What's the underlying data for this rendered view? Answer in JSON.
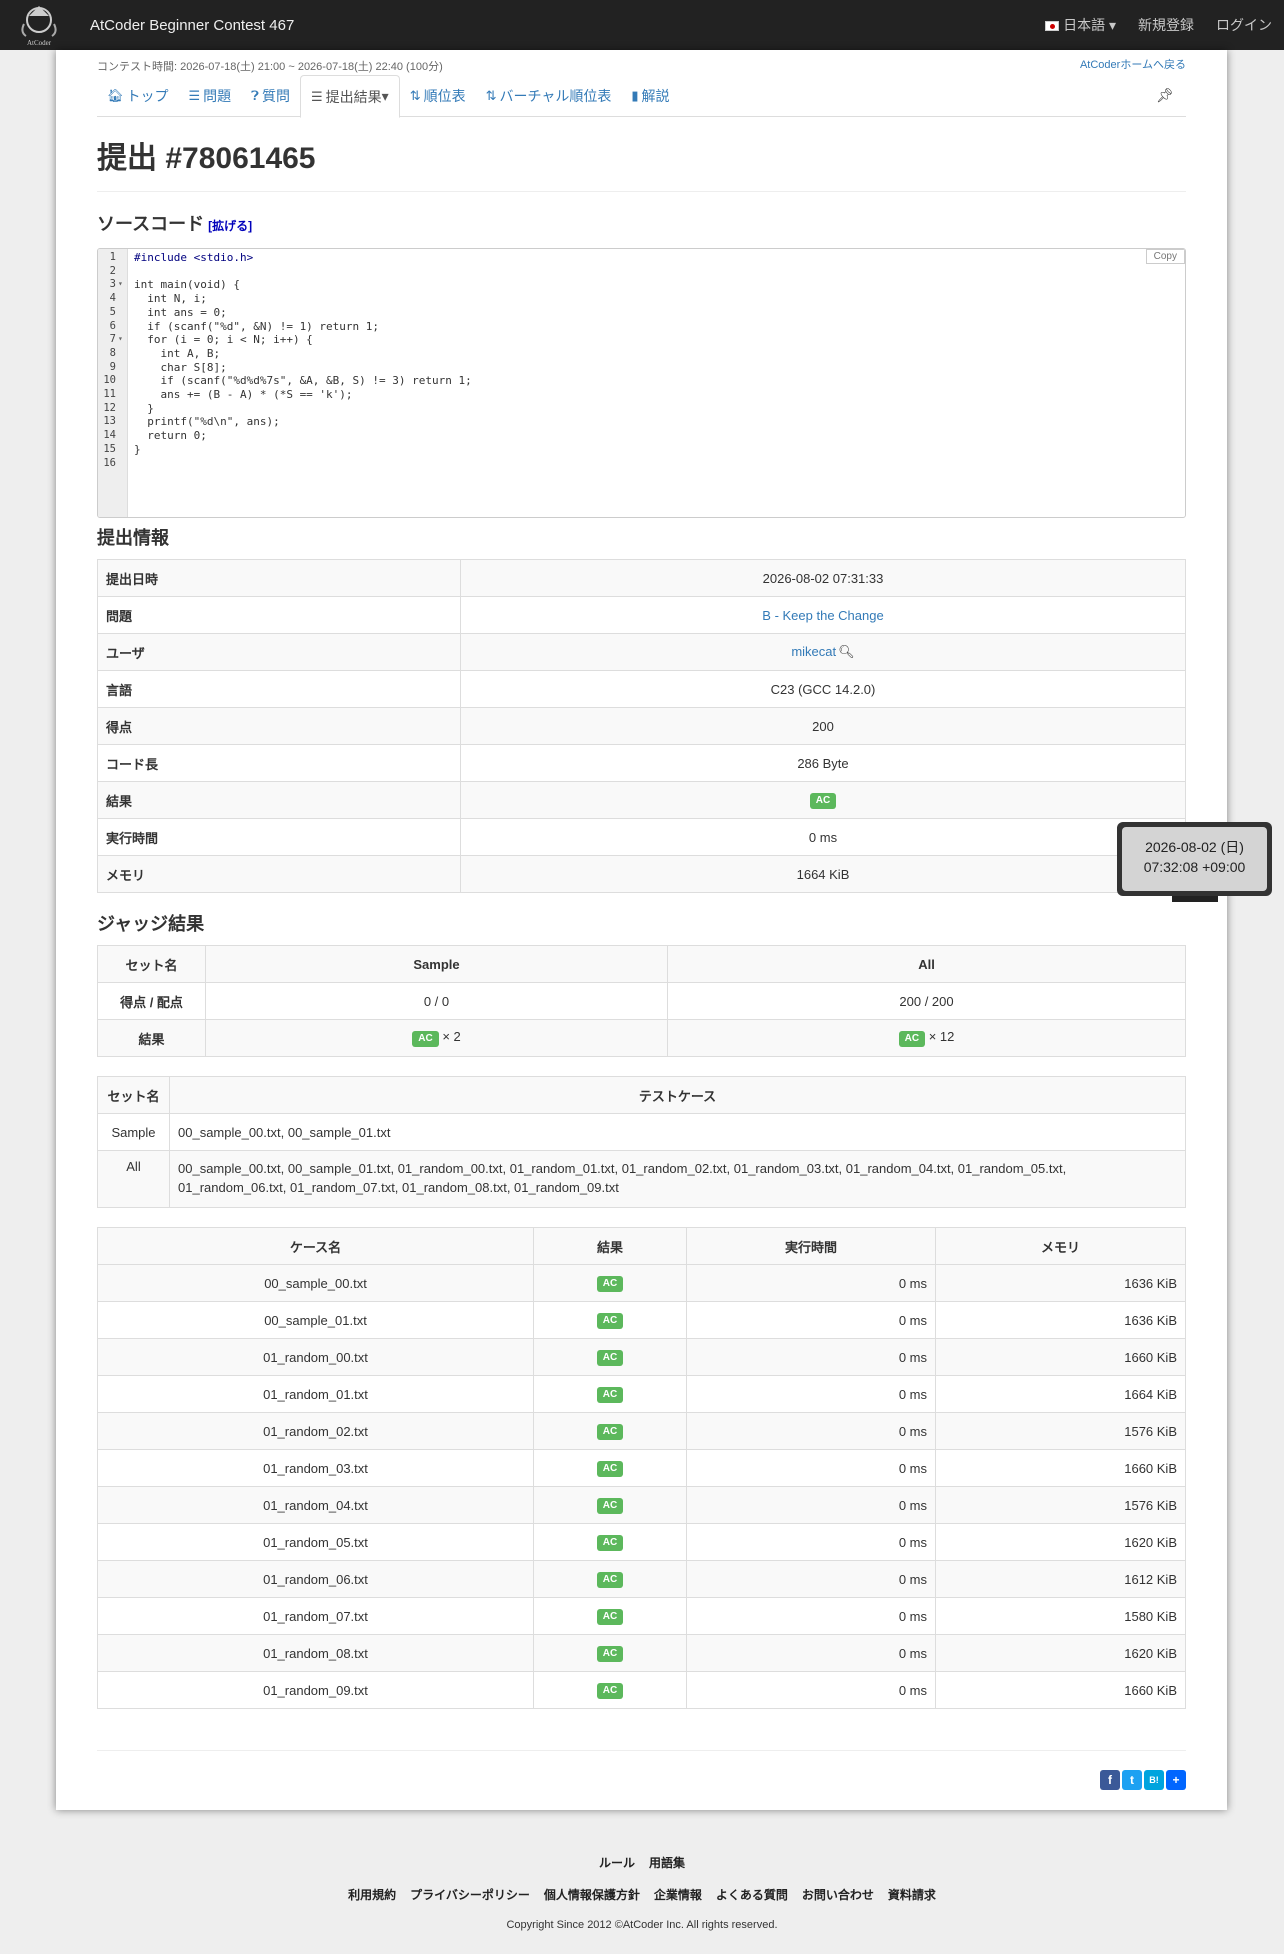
{
  "navbar": {
    "logo_text": "AtCoder",
    "contest_title": "AtCoder Beginner Contest 467",
    "language": "日本語",
    "signup": "新規登録",
    "login": "ログイン"
  },
  "contest_time": "コンテスト時間: 2026-07-18(土) 21:00 ~ 2026-07-18(土) 22:40 (100分)",
  "home_link": "AtCoderホームへ戻る",
  "tabs": [
    {
      "icon": "home-icon",
      "label": "トップ"
    },
    {
      "icon": "list-icon",
      "label": "問題"
    },
    {
      "icon": "question-icon",
      "label": "質問"
    },
    {
      "icon": "list-icon",
      "label": "提出結果"
    },
    {
      "icon": "sort-icon",
      "label": "順位表"
    },
    {
      "icon": "sort-icon",
      "label": "バーチャル順位表"
    },
    {
      "icon": "book-icon",
      "label": "解説"
    }
  ],
  "page_title": "提出 #78061465",
  "source_heading": "ソースコード",
  "expand_label": "[拡げる]",
  "copy_label": "Copy",
  "code_lines": [
    "#include <stdio.h>",
    "",
    "int main(void) {",
    "  int N, i;",
    "  int ans = 0;",
    "  if (scanf(\"%d\", &N) != 1) return 1;",
    "  for (i = 0; i < N; i++) {",
    "    int A, B;",
    "    char S[8];",
    "    if (scanf(\"%d%d%7s\", &A, &B, S) != 3) return 1;",
    "    ans += (B - A) * (*S == 'k');",
    "  }",
    "  printf(\"%d\\n\", ans);",
    "  return 0;",
    "}",
    ""
  ],
  "info_heading": "提出情報",
  "info": [
    {
      "key": "提出日時",
      "value": "2026-08-02 07:31:33"
    },
    {
      "key": "問題",
      "value": "B - Keep the Change"
    },
    {
      "key": "ユーザ",
      "value": "mikecat"
    },
    {
      "key": "言語",
      "value": "C23 (GCC 14.2.0)"
    },
    {
      "key": "得点",
      "value": "200"
    },
    {
      "key": "コード長",
      "value": "286 Byte"
    },
    {
      "key": "結果",
      "value": "AC"
    },
    {
      "key": "実行時間",
      "value": "0 ms"
    },
    {
      "key": "メモリ",
      "value": "1664 KiB"
    }
  ],
  "tooltip": {
    "line1": "2026-08-02 (日)",
    "line2": "07:32:08 +09:00"
  },
  "judge_heading": "ジャッジ結果",
  "judge": {
    "headers": [
      "セット名",
      "Sample",
      "All"
    ],
    "score_label": "得点 / 配点",
    "scores": [
      "0 / 0",
      "200 / 200"
    ],
    "result_label": "結果",
    "result_badge": "AC",
    "result_counts": [
      "× 2",
      "× 12"
    ]
  },
  "testsets": {
    "headers": [
      "セット名",
      "テストケース"
    ],
    "rows": [
      {
        "set": "Sample",
        "files": "00_sample_00.txt, 00_sample_01.txt"
      },
      {
        "set": "All",
        "files": "00_sample_00.txt, 00_sample_01.txt, 01_random_00.txt, 01_random_01.txt, 01_random_02.txt, 01_random_03.txt, 01_random_04.txt, 01_random_05.txt, 01_random_06.txt, 01_random_07.txt, 01_random_08.txt, 01_random_09.txt"
      }
    ]
  },
  "cases": {
    "headers": [
      "ケース名",
      "結果",
      "実行時間",
      "メモリ"
    ],
    "rows": [
      {
        "name": "00_sample_00.txt",
        "result": "AC",
        "time": "0 ms",
        "memory": "1636 KiB"
      },
      {
        "name": "00_sample_01.txt",
        "result": "AC",
        "time": "0 ms",
        "memory": "1636 KiB"
      },
      {
        "name": "01_random_00.txt",
        "result": "AC",
        "time": "0 ms",
        "memory": "1660 KiB"
      },
      {
        "name": "01_random_01.txt",
        "result": "AC",
        "time": "0 ms",
        "memory": "1664 KiB"
      },
      {
        "name": "01_random_02.txt",
        "result": "AC",
        "time": "0 ms",
        "memory": "1576 KiB"
      },
      {
        "name": "01_random_03.txt",
        "result": "AC",
        "time": "0 ms",
        "memory": "1660 KiB"
      },
      {
        "name": "01_random_04.txt",
        "result": "AC",
        "time": "0 ms",
        "memory": "1576 KiB"
      },
      {
        "name": "01_random_05.txt",
        "result": "AC",
        "time": "0 ms",
        "memory": "1620 KiB"
      },
      {
        "name": "01_random_06.txt",
        "result": "AC",
        "time": "0 ms",
        "memory": "1612 KiB"
      },
      {
        "name": "01_random_07.txt",
        "result": "AC",
        "time": "0 ms",
        "memory": "1580 KiB"
      },
      {
        "name": "01_random_08.txt",
        "result": "AC",
        "time": "0 ms",
        "memory": "1620 KiB"
      },
      {
        "name": "01_random_09.txt",
        "result": "AC",
        "time": "0 ms",
        "memory": "1660 KiB"
      }
    ]
  },
  "share": [
    "facebook-icon",
    "twitter-icon",
    "hatena-icon",
    "plus-icon"
  ],
  "share_hatena_label": "B!",
  "footer": {
    "row1": [
      "ルール",
      "用語集"
    ],
    "row2": [
      "利用規約",
      "プライバシーポリシー",
      "個人情報保護方針",
      "企業情報",
      "よくある質問",
      "お問い合わせ",
      "資料請求"
    ],
    "copyright": "Copyright Since 2012 ©AtCoder Inc. All rights reserved."
  },
  "colors": {
    "navbar": "#222222",
    "ac_badge": "#5cb85c",
    "link": "#337ab7"
  }
}
